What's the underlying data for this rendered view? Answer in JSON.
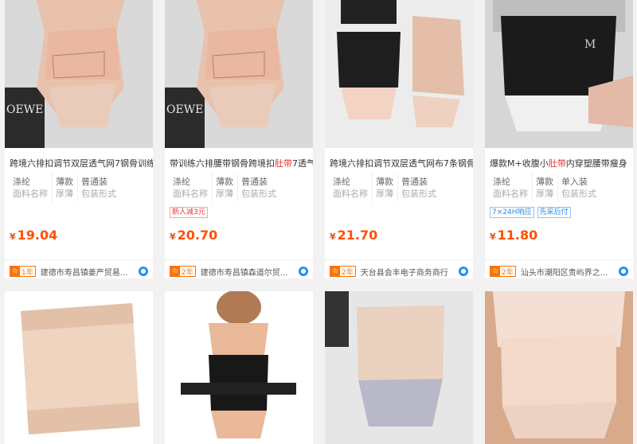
{
  "products": [
    {
      "title_parts": [
        "跨境六排扣调节双层透气网7钢骨训练",
        "",
        ""
      ],
      "attrs": [
        {
          "v": "涤纶",
          "k": "面料名称"
        },
        {
          "v": "薄款",
          "k": "厚薄"
        },
        {
          "v": "普通装",
          "k": "包装形式"
        }
      ],
      "tags": [],
      "currency": "¥",
      "price": "19.04",
      "years_label": "1年",
      "shop": "建德市寿昌镇姜严贸易...",
      "image_watermark": "图标"
    },
    {
      "title_parts": [
        "带训练六排腰带钢骨跨境扣",
        "肚带",
        "7透气"
      ],
      "attrs": [
        {
          "v": "涤纶",
          "k": "面料名称"
        },
        {
          "v": "薄款",
          "k": "厚薄"
        },
        {
          "v": "普通装",
          "k": "包装形式"
        }
      ],
      "tags": [
        {
          "text": "新人减3元",
          "style": "red"
        }
      ],
      "currency": "¥",
      "price": "20.70",
      "years_label": "2年",
      "shop": "建德市寿昌镇森道尔贸...",
      "image_watermark": ""
    },
    {
      "title_parts": [
        "跨境六排扣调节双层透气网布7条钢骨",
        "",
        ""
      ],
      "attrs": [
        {
          "v": "涤纶",
          "k": "面料名称"
        },
        {
          "v": "薄款",
          "k": "厚薄"
        },
        {
          "v": "普通装",
          "k": "包装形式"
        }
      ],
      "tags": [],
      "currency": "¥",
      "price": "21.70",
      "years_label": "2年",
      "shop": "天台县会丰电子商务商行",
      "image_watermark": ""
    },
    {
      "title_parts": [
        "爆款M+收腹小",
        "肚带",
        "内穿塑腰带瘦身"
      ],
      "attrs": [
        {
          "v": "涤纶",
          "k": "面料名称"
        },
        {
          "v": "薄款",
          "k": "厚薄"
        },
        {
          "v": "单入装",
          "k": "包装形式"
        }
      ],
      "tags": [
        {
          "text": "7×24H响应",
          "style": "blue"
        },
        {
          "text": "先采后付",
          "style": "blue"
        }
      ],
      "currency": "¥",
      "price": "11.80",
      "years_label": "2年",
      "shop": "汕头市潮阳区贵屿界之...",
      "image_watermark": ""
    }
  ],
  "second_row_images": [
    {
      "name": "beige-perforated-belt-image"
    },
    {
      "name": "black-waist-trainer-model-image"
    },
    {
      "name": "beige-corset-model-image"
    },
    {
      "name": "beige-belly-band-model-image"
    }
  ],
  "colors": {
    "price": "#ff5000",
    "highlight": "#e4393c",
    "years_badge": "#ff7300",
    "verify": "#2a8be8"
  }
}
